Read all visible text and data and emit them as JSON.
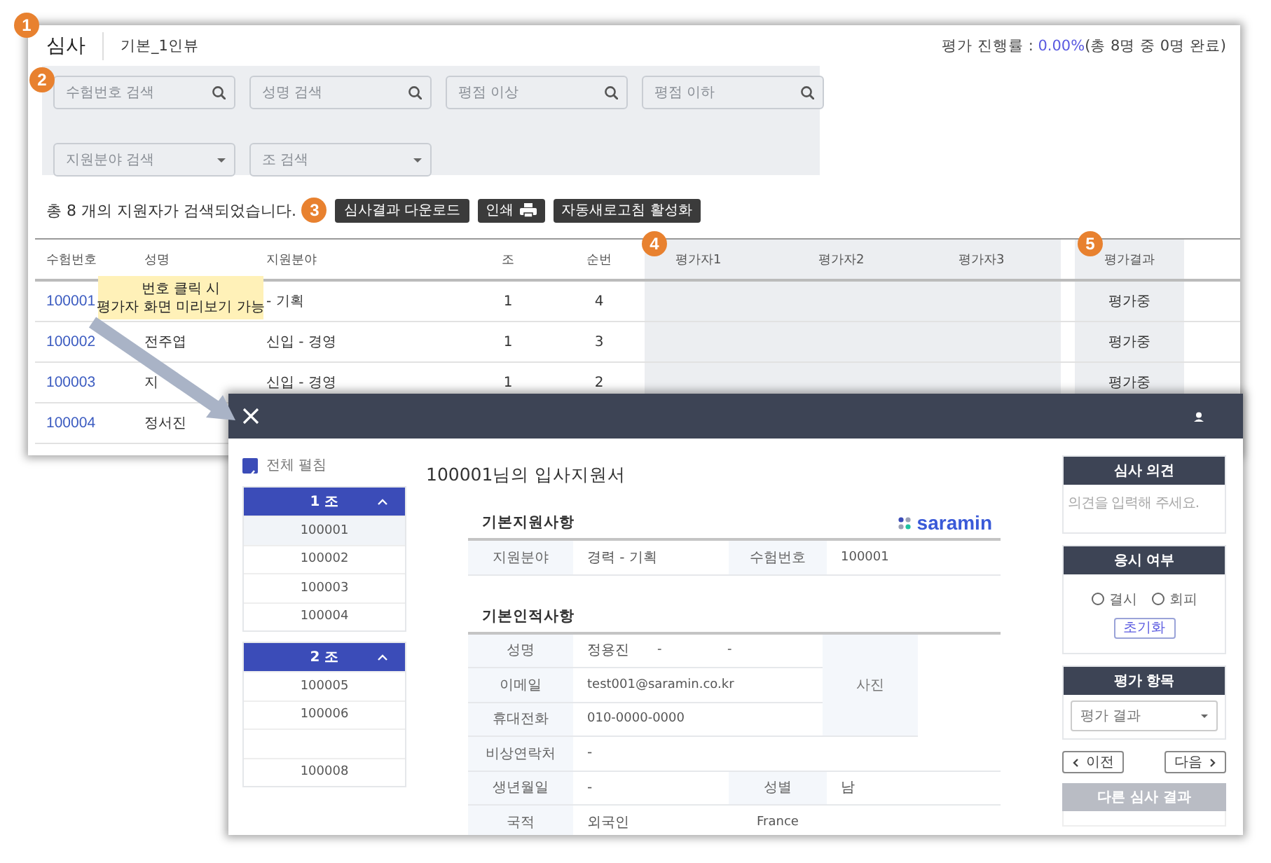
{
  "main_window": {
    "badge": "1",
    "title": "심사",
    "subtitle": "기본_1인뷰",
    "progress": {
      "label": "평가 진행률 :",
      "value": "0.00%",
      "detail": "(총 8명 중 0명 완료)"
    },
    "filters": {
      "badge": "2",
      "fields": [
        {
          "kind": "search",
          "placeholder": "수험번호 검색"
        },
        {
          "kind": "search",
          "placeholder": "성명 검색"
        },
        {
          "kind": "search",
          "placeholder": "평점 이상"
        },
        {
          "kind": "search",
          "placeholder": "평점 이하"
        },
        {
          "kind": "select",
          "placeholder": "지원분야 검색"
        },
        {
          "kind": "select",
          "placeholder": "조 검색"
        }
      ]
    },
    "result_count": "총 8 개의 지원자가 검색되었습니다.",
    "toolbar": {
      "badge": "3",
      "buttons": [
        {
          "label": "심사결과 다운로드",
          "kind": "plain"
        },
        {
          "label": "인쇄",
          "kind": "with_icon"
        },
        {
          "label": "자동새로고침 활성화",
          "kind": "plain"
        }
      ]
    },
    "table": {
      "columns": [
        {
          "label": "수험번호",
          "kind": "plain"
        },
        {
          "label": "성명",
          "kind": "plain"
        },
        {
          "label": "지원분야",
          "kind": "plain"
        },
        {
          "label": "조",
          "kind": "center"
        },
        {
          "label": "순번",
          "kind": "center"
        },
        {
          "label": "평가자1",
          "kind": "evaluator",
          "badge": "4"
        },
        {
          "label": "평가자2",
          "kind": "evaluator"
        },
        {
          "label": "평가자3",
          "kind": "evaluator"
        },
        {
          "label": "평가결과",
          "kind": "result",
          "badge": "5"
        }
      ],
      "rows": [
        {
          "number": "100001",
          "field": "- 기획",
          "group": "1",
          "order": "4",
          "result": "평가중"
        },
        {
          "number": "100002",
          "name": "전주엽",
          "field": "신입 - 경영",
          "group": "1",
          "order": "3",
          "result": "평가중"
        },
        {
          "number": "100003",
          "name": "지",
          "field": "신입 - 경영",
          "group": "1",
          "order": "2",
          "result": "평가중"
        },
        {
          "number": "100004",
          "name": "정서진"
        }
      ]
    }
  },
  "callout": {
    "lines": [
      "번호 클릭 시",
      "평가자 화면 미리보기 가능"
    ]
  },
  "preview_window": {
    "expand_all": {
      "label": "전체 펼침",
      "checked": true
    },
    "groups": [
      {
        "label": "1 조",
        "expanded": true,
        "items": [
          {
            "kind": "entry",
            "number": "100001",
            "selected": true
          },
          {
            "kind": "entry",
            "number": "100002",
            "selected": false
          },
          {
            "kind": "entry",
            "number": "100003",
            "selected": false
          },
          {
            "kind": "entry",
            "number": "100004",
            "selected": false
          }
        ]
      },
      {
        "label": "2 조",
        "expanded": true,
        "items": [
          {
            "kind": "entry",
            "number": "100005",
            "selected": false
          },
          {
            "kind": "entry",
            "number": "100006",
            "selected": false
          },
          {
            "kind": "empty",
            "selected": false
          },
          {
            "kind": "entry",
            "number": "100008",
            "selected": false
          }
        ]
      }
    ],
    "document": {
      "title": "100001님의 입사지원서",
      "logo": "saramin",
      "application": {
        "heading": "기본지원사항",
        "label": "지원분야",
        "value": "경력 - 기획",
        "label2": "수험번호",
        "value2": "100001"
      },
      "personal": {
        "heading": "기본인적사항",
        "photo": "사진",
        "rows_beside_photo": [
          {
            "label": "성명",
            "values": [
              "정용진",
              "-",
              "-"
            ]
          },
          {
            "label": "이메일",
            "values": [
              "test001@saramin.co.kr"
            ]
          },
          {
            "label": "휴대전화",
            "values": [
              "010-0000-0000"
            ]
          }
        ],
        "rows": [
          {
            "label": "비상연락처",
            "value": "-"
          },
          {
            "label": "생년월일",
            "value": "-",
            "label2": "성별",
            "value2": "남"
          },
          {
            "label": "국적",
            "value": "외국인",
            "value2": "France"
          }
        ]
      }
    },
    "review": {
      "opinion": {
        "heading": "심사 의견",
        "placeholder": "의견을 입력해 주세요."
      },
      "attendance": {
        "heading": "응시 여부",
        "options": [
          {
            "label": "결시",
            "selected": false
          },
          {
            "label": "회피",
            "selected": false
          }
        ],
        "reset": "초기화"
      },
      "evaluation": {
        "heading": "평가 항목",
        "placeholder": "평가 결과"
      },
      "prev": "이전",
      "next": "다음",
      "other_results": "다른 심사 결과"
    }
  }
}
